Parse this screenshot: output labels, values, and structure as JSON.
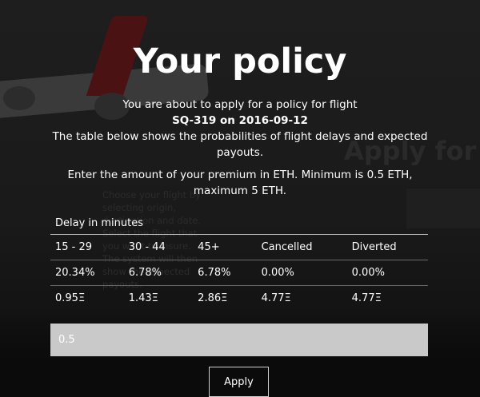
{
  "header": {
    "title": "Your policy"
  },
  "intro": {
    "line1": "You are about to apply for a policy for flight",
    "flight_line": "SQ-319 on 2016-09-12",
    "line3": "The table below shows the probabilities of flight delays and expected payouts."
  },
  "premium_note": "Enter the amount of your premium in ETH. Minimum is 0.5 ETH, maximum 5 ETH.",
  "table": {
    "caption": "Delay in minutes",
    "columns": [
      "15 - 29",
      "30 - 44",
      "45+",
      "Cancelled",
      "Diverted"
    ],
    "probabilities": [
      "20.34%",
      "6.78%",
      "6.78%",
      "0.00%",
      "0.00%"
    ],
    "payouts": [
      "0.95Ξ",
      "1.43Ξ",
      "2.86Ξ",
      "4.77Ξ",
      "4.77Ξ"
    ]
  },
  "premium_input": {
    "value": "0.5"
  },
  "apply_button": {
    "label": "Apply"
  },
  "background": {
    "title": "Apply for",
    "text": "Choose your flight by selecting origin, destination and date. Select the flight that you want to insure. The system will then show the expected payouts."
  }
}
